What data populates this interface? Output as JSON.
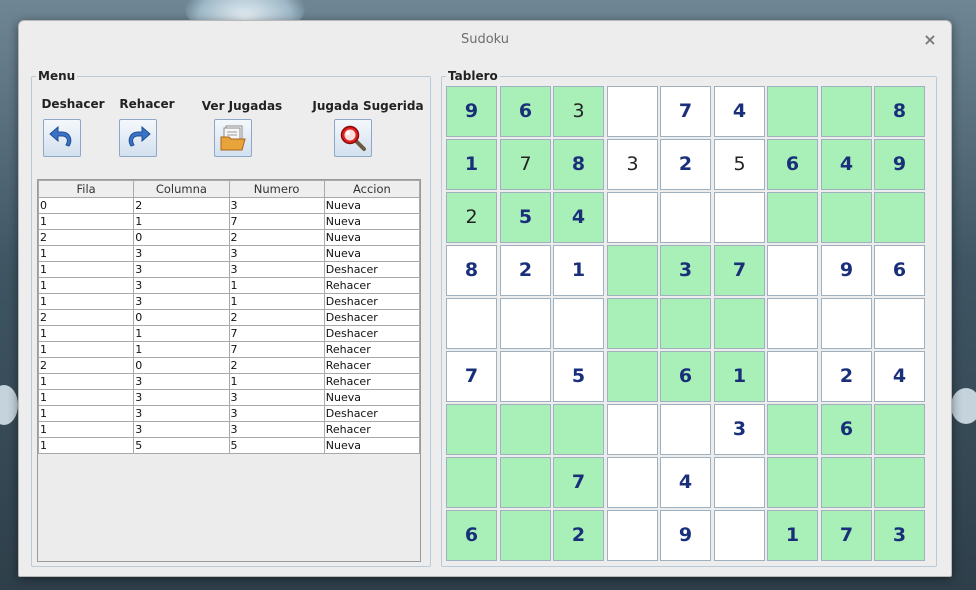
{
  "window": {
    "title": "Sudoku",
    "close_glyph": "×"
  },
  "menu": {
    "legend": "Menu",
    "buttons": [
      {
        "label": "Deshacer",
        "icon": "undo-icon"
      },
      {
        "label": "Rehacer",
        "icon": "redo-icon"
      },
      {
        "label": "Ver Jugadas",
        "icon": "folder-icon"
      },
      {
        "label": "Jugada Sugerida",
        "icon": "magnifier-icon"
      }
    ]
  },
  "history": {
    "columns": [
      "Fila",
      "Columna",
      "Numero",
      "Accion"
    ],
    "rows": [
      [
        "0",
        "2",
        "3",
        "Nueva"
      ],
      [
        "1",
        "1",
        "7",
        "Nueva"
      ],
      [
        "2",
        "0",
        "2",
        "Nueva"
      ],
      [
        "1",
        "3",
        "3",
        "Nueva"
      ],
      [
        "1",
        "3",
        "3",
        "Deshacer"
      ],
      [
        "1",
        "3",
        "1",
        "Rehacer"
      ],
      [
        "1",
        "3",
        "1",
        "Deshacer"
      ],
      [
        "2",
        "0",
        "2",
        "Deshacer"
      ],
      [
        "1",
        "1",
        "7",
        "Deshacer"
      ],
      [
        "1",
        "1",
        "7",
        "Rehacer"
      ],
      [
        "2",
        "0",
        "2",
        "Rehacer"
      ],
      [
        "1",
        "3",
        "1",
        "Rehacer"
      ],
      [
        "1",
        "3",
        "3",
        "Nueva"
      ],
      [
        "1",
        "3",
        "3",
        "Deshacer"
      ],
      [
        "1",
        "3",
        "3",
        "Rehacer"
      ],
      [
        "1",
        "5",
        "5",
        "Nueva"
      ]
    ]
  },
  "board": {
    "legend": "Tablero",
    "colors": {
      "green": "#a8f0b8",
      "white": "#ffffff",
      "fixed_digit": "#1a2f7a",
      "user_digit": "#232323"
    },
    "cells": [
      [
        {
          "v": "9",
          "bg": "green",
          "fixed": true
        },
        {
          "v": "6",
          "bg": "green",
          "fixed": true
        },
        {
          "v": "3",
          "bg": "green",
          "fixed": false
        },
        {
          "v": "",
          "bg": "white",
          "fixed": false
        },
        {
          "v": "7",
          "bg": "white",
          "fixed": true
        },
        {
          "v": "4",
          "bg": "white",
          "fixed": true
        },
        {
          "v": "",
          "bg": "green",
          "fixed": false
        },
        {
          "v": "",
          "bg": "green",
          "fixed": false
        },
        {
          "v": "8",
          "bg": "green",
          "fixed": true
        }
      ],
      [
        {
          "v": "1",
          "bg": "green",
          "fixed": true
        },
        {
          "v": "7",
          "bg": "green",
          "fixed": false
        },
        {
          "v": "8",
          "bg": "green",
          "fixed": true
        },
        {
          "v": "3",
          "bg": "white",
          "fixed": false
        },
        {
          "v": "2",
          "bg": "white",
          "fixed": true
        },
        {
          "v": "5",
          "bg": "white",
          "fixed": false
        },
        {
          "v": "6",
          "bg": "green",
          "fixed": true
        },
        {
          "v": "4",
          "bg": "green",
          "fixed": true
        },
        {
          "v": "9",
          "bg": "green",
          "fixed": true
        }
      ],
      [
        {
          "v": "2",
          "bg": "green",
          "fixed": false
        },
        {
          "v": "5",
          "bg": "green",
          "fixed": true
        },
        {
          "v": "4",
          "bg": "green",
          "fixed": true
        },
        {
          "v": "",
          "bg": "white",
          "fixed": false
        },
        {
          "v": "",
          "bg": "white",
          "fixed": false
        },
        {
          "v": "",
          "bg": "white",
          "fixed": false
        },
        {
          "v": "",
          "bg": "green",
          "fixed": false
        },
        {
          "v": "",
          "bg": "green",
          "fixed": false
        },
        {
          "v": "",
          "bg": "green",
          "fixed": false
        }
      ],
      [
        {
          "v": "8",
          "bg": "white",
          "fixed": true
        },
        {
          "v": "2",
          "bg": "white",
          "fixed": true
        },
        {
          "v": "1",
          "bg": "white",
          "fixed": true
        },
        {
          "v": "",
          "bg": "green",
          "fixed": false
        },
        {
          "v": "3",
          "bg": "green",
          "fixed": true
        },
        {
          "v": "7",
          "bg": "green",
          "fixed": true
        },
        {
          "v": "",
          "bg": "white",
          "fixed": false
        },
        {
          "v": "9",
          "bg": "white",
          "fixed": true
        },
        {
          "v": "6",
          "bg": "white",
          "fixed": true
        }
      ],
      [
        {
          "v": "",
          "bg": "white",
          "fixed": false
        },
        {
          "v": "",
          "bg": "white",
          "fixed": false
        },
        {
          "v": "",
          "bg": "white",
          "fixed": false
        },
        {
          "v": "",
          "bg": "green",
          "fixed": false
        },
        {
          "v": "",
          "bg": "green",
          "fixed": false
        },
        {
          "v": "",
          "bg": "green",
          "fixed": false
        },
        {
          "v": "",
          "bg": "white",
          "fixed": false
        },
        {
          "v": "",
          "bg": "white",
          "fixed": false
        },
        {
          "v": "",
          "bg": "white",
          "fixed": false
        }
      ],
      [
        {
          "v": "7",
          "bg": "white",
          "fixed": true
        },
        {
          "v": "",
          "bg": "white",
          "fixed": false
        },
        {
          "v": "5",
          "bg": "white",
          "fixed": true
        },
        {
          "v": "",
          "bg": "green",
          "fixed": false
        },
        {
          "v": "6",
          "bg": "green",
          "fixed": true
        },
        {
          "v": "1",
          "bg": "green",
          "fixed": true
        },
        {
          "v": "",
          "bg": "white",
          "fixed": false
        },
        {
          "v": "2",
          "bg": "white",
          "fixed": true
        },
        {
          "v": "4",
          "bg": "white",
          "fixed": true
        }
      ],
      [
        {
          "v": "",
          "bg": "green",
          "fixed": false
        },
        {
          "v": "",
          "bg": "green",
          "fixed": false
        },
        {
          "v": "",
          "bg": "green",
          "fixed": false
        },
        {
          "v": "",
          "bg": "white",
          "fixed": false
        },
        {
          "v": "",
          "bg": "white",
          "fixed": false
        },
        {
          "v": "3",
          "bg": "white",
          "fixed": true
        },
        {
          "v": "",
          "bg": "green",
          "fixed": false
        },
        {
          "v": "6",
          "bg": "green",
          "fixed": true
        },
        {
          "v": "",
          "bg": "green",
          "fixed": false
        }
      ],
      [
        {
          "v": "",
          "bg": "green",
          "fixed": false
        },
        {
          "v": "",
          "bg": "green",
          "fixed": false
        },
        {
          "v": "7",
          "bg": "green",
          "fixed": true
        },
        {
          "v": "",
          "bg": "white",
          "fixed": false
        },
        {
          "v": "4",
          "bg": "white",
          "fixed": true
        },
        {
          "v": "",
          "bg": "white",
          "fixed": false
        },
        {
          "v": "",
          "bg": "green",
          "fixed": false
        },
        {
          "v": "",
          "bg": "green",
          "fixed": false
        },
        {
          "v": "",
          "bg": "green",
          "fixed": false
        }
      ],
      [
        {
          "v": "6",
          "bg": "green",
          "fixed": true
        },
        {
          "v": "",
          "bg": "green",
          "fixed": false
        },
        {
          "v": "2",
          "bg": "green",
          "fixed": true
        },
        {
          "v": "",
          "bg": "white",
          "fixed": false
        },
        {
          "v": "9",
          "bg": "white",
          "fixed": true
        },
        {
          "v": "",
          "bg": "white",
          "fixed": false
        },
        {
          "v": "1",
          "bg": "green",
          "fixed": true
        },
        {
          "v": "7",
          "bg": "green",
          "fixed": true
        },
        {
          "v": "3",
          "bg": "green",
          "fixed": true
        }
      ]
    ]
  }
}
